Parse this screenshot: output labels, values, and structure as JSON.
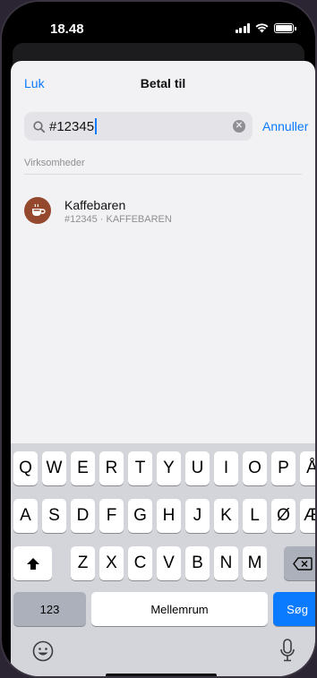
{
  "status": {
    "time": "18.48"
  },
  "nav": {
    "close": "Luk",
    "title": "Betal til"
  },
  "search": {
    "value": "#12345",
    "cancel": "Annuller"
  },
  "section": {
    "header": "Virksomheder"
  },
  "results": [
    {
      "name": "Kaffebaren",
      "subtitle": "#12345 · KAFFEBAREN",
      "icon": "coffee-cup-icon"
    }
  ],
  "keyboard": {
    "row1": [
      "Q",
      "W",
      "E",
      "R",
      "T",
      "Y",
      "U",
      "I",
      "O",
      "P",
      "Å"
    ],
    "row2": [
      "A",
      "S",
      "D",
      "F",
      "G",
      "H",
      "J",
      "K",
      "L",
      "Ø",
      "Æ"
    ],
    "row3": [
      "Z",
      "X",
      "C",
      "V",
      "B",
      "N",
      "M"
    ],
    "numbers": "123",
    "space": "Mellemrum",
    "action": "Søg"
  },
  "colors": {
    "accent": "#0a7aff",
    "avatar": "#94482d",
    "sheet": "#f2f2f4",
    "keyboard": "#d4d5da"
  }
}
